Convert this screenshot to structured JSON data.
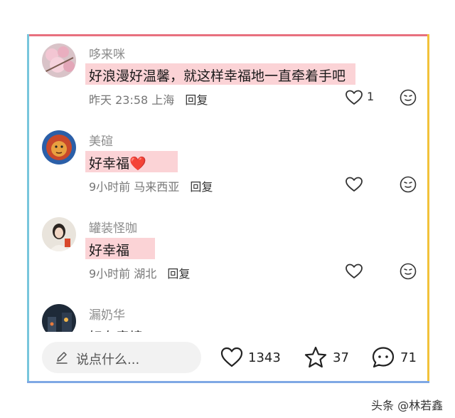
{
  "comments": [
    {
      "username": "哆来咪",
      "text": "好浪漫好温馨，就这样幸福地一直牵着手吧",
      "time": "昨天 23:58",
      "location": "上海",
      "reply": "回复",
      "likes": "1",
      "avatar": "cherry-blossom-avatar"
    },
    {
      "username": "美碹",
      "text": "好幸福",
      "emoji": "❤️",
      "time": "9小时前",
      "location": "马来西亚",
      "reply": "回复",
      "likes": "",
      "avatar": "lion-avatar"
    },
    {
      "username": "罐装怪咖",
      "text": "好幸福",
      "time": "9小时前",
      "location": "湖北",
      "reply": "回复",
      "likes": "",
      "avatar": "girl-avatar"
    },
    {
      "username": "漏奶华",
      "text": "好有意境",
      "avatar": "night-street-avatar"
    }
  ],
  "bottom_bar": {
    "input_placeholder": "说点什么...",
    "like_count": "1343",
    "star_count": "37",
    "comment_count": "71"
  },
  "watermark": "头条 @林若鑫",
  "colors": {
    "highlight": "#fbd3d6",
    "border_top": "#e8707e",
    "border_left": "#78c6dc",
    "border_right": "#f2c23a",
    "border_bottom": "#7fa8e4",
    "heart": "#e8384f"
  }
}
